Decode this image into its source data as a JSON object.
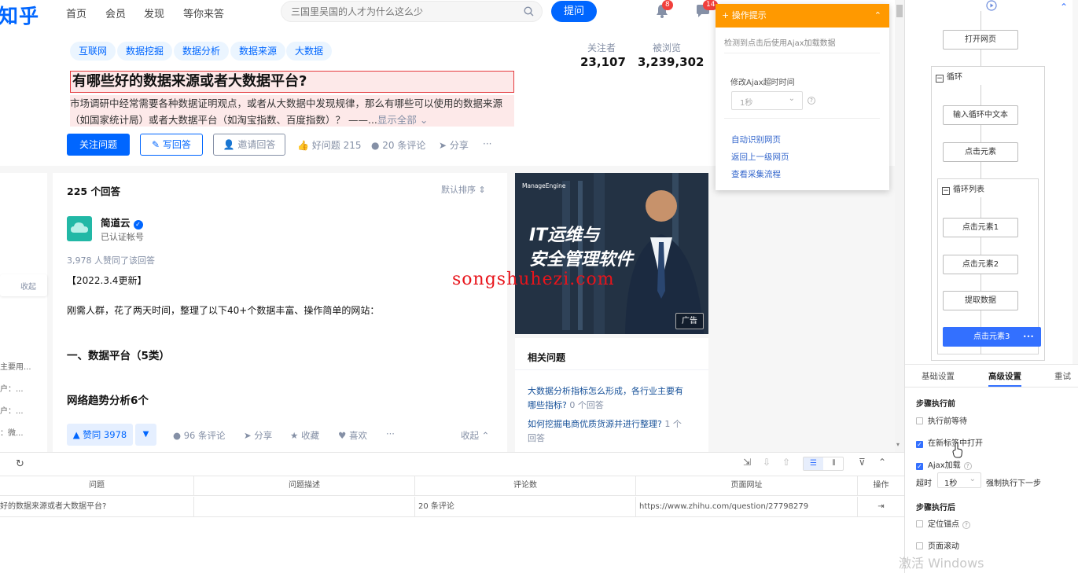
{
  "topbar": {
    "logo": "知乎",
    "nav": [
      "首页",
      "会员",
      "发现",
      "等你来答"
    ],
    "search_placeholder": "三国里吴国的人才为什么这么少",
    "ask_label": "提问",
    "notif_badge": "8",
    "msg_badge": "14"
  },
  "question": {
    "tags": [
      "互联网",
      "数据挖掘",
      "数据分析",
      "数据来源",
      "大数据"
    ],
    "followers_label": "关注者",
    "followers_value": "23,107",
    "views_label": "被浏览",
    "views_value": "3,239,302",
    "title": "有哪些好的数据来源或者大数据平台?",
    "desc_line1": "市场调研中经常需要各种数据证明观点，或者从大数据中发现规律，那么有哪些可以使用的数据来源",
    "desc_line2": "（如国家统计局）或者大数据平台（如淘宝指数、百度指数）？ ——...",
    "show_all": "显示全部",
    "follow_btn": "关注问题",
    "write_btn": "写回答",
    "invite_btn": "邀请回答",
    "good_q": "好问题 215",
    "comments": "20 条评论",
    "share": "分享",
    "more": "···"
  },
  "left_col": {
    "collect": "收起",
    "snippets": [
      "主要用...",
      "户：...",
      "户：...",
      "：微..."
    ]
  },
  "answer": {
    "count": "225 个回答",
    "sort": "默认排序",
    "author": "简道云",
    "author_sub": "已认证帐号",
    "likes_text": "3,978 人赞同了该回答",
    "update": "【2022.3.4更新】",
    "intro": "刚需人群，花了两天时间，整理了以下40+个数据丰富、操作简单的网站：",
    "h1": "一、数据平台（5类）",
    "h2": "网络趋势分析6个",
    "vote": "▲ 赞同 3978",
    "comments": "96 条评论",
    "share": "分享",
    "fav": "收藏",
    "like": "喜欢",
    "more": "···",
    "collapse": "收起"
  },
  "ad": {
    "brand": "ManageEngine",
    "line1": "IT运维与",
    "line2": "安全管理软件",
    "label": "广告"
  },
  "related": {
    "title": "相关问题",
    "q1a": "大数据分析指标怎么形成，各行业主要有",
    "q1b": "哪些指标?",
    "q1c": " 0 个回答",
    "q2a": "如何挖掘电商优质货源并进行整理?",
    "q2b": " 1 个",
    "q2c": "回答"
  },
  "watermark": "songshuhezi.com",
  "popup": {
    "title": "操作提示",
    "hint": "检测到点击后使用Ajax加载数据",
    "modify_label": "修改Ajax超时时间",
    "timeout_value": "1秒",
    "links": [
      "自动识别网页",
      "返回上一级网页",
      "查看采集流程"
    ]
  },
  "table": {
    "headers": [
      "问题",
      "问题描述",
      "评论数",
      "页面网址",
      "操作"
    ],
    "rows": [
      [
        "好的数据来源或者大数据平台?",
        "",
        "20 条评论",
        "https://www.zhihu.com/question/27798279",
        "⇥"
      ]
    ]
  },
  "workflow": {
    "nodes": {
      "open": "打开网页",
      "loop": "循环",
      "input_text": "输入循环中文本",
      "click": "点击元素",
      "loop_list": "循环列表",
      "click1": "点击元素1",
      "click2": "点击元素2",
      "extract": "提取数据",
      "click3": "点击元素3",
      "click3_more": "•••"
    },
    "tabs": [
      "基础设置",
      "高级设置",
      "重试"
    ],
    "before_title": "步骤执行前",
    "wait_before": "执行前等待",
    "open_new_tab": "在新标签中打开",
    "ajax": "Ajax加载",
    "timeout_label": "超时",
    "timeout_value": "1秒",
    "force_next": "强制执行下一步",
    "after_title": "步骤执行后",
    "anchor": "定位锚点",
    "scroll": "页面滚动",
    "windows": "激活 Windows"
  },
  "colors": {
    "zhihu_blue": "#0066ff",
    "popup_orange": "#ff9900",
    "selected_node": "#3370ff",
    "highlight_red": "#e4393c"
  }
}
